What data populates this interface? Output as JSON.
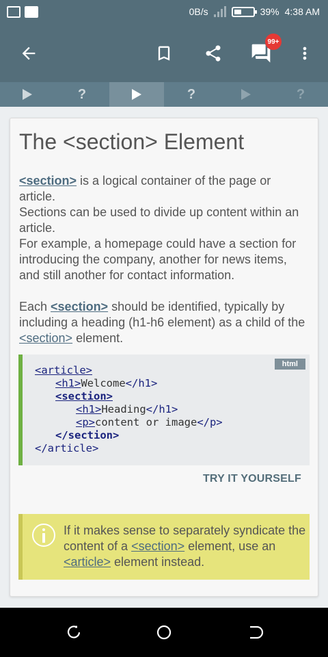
{
  "status_bar": {
    "net_speed": "0B/s",
    "battery_percent": "39%",
    "battery_level": 0.39,
    "time": "4:38 AM",
    "icons": [
      "screen-cast-icon",
      "activity-icon",
      "signal-icon",
      "battery-icon"
    ]
  },
  "app_bar": {
    "badge": "99+",
    "icons": [
      "back-arrow-icon",
      "bookmark-icon",
      "share-icon",
      "comments-icon",
      "more-vert-icon"
    ]
  },
  "lesson_nav": {
    "steps": [
      {
        "type": "play",
        "label": ""
      },
      {
        "type": "quiz",
        "label": "?"
      },
      {
        "type": "play",
        "label": "",
        "active": true
      },
      {
        "type": "quiz",
        "label": "?"
      },
      {
        "type": "play",
        "label": "",
        "disabled": true
      },
      {
        "type": "quiz",
        "label": "?",
        "disabled": true
      }
    ]
  },
  "card": {
    "title": "The <section> Element",
    "p1": {
      "link": "<section>",
      "line1_rest": " is a logical container of the page or article.",
      "line2": "Sections can be used to divide up content within an article.",
      "line3": "For example, a homepage could have a section for introducing the company, another for news items, and still another for contact information."
    },
    "p2": {
      "pre": "Each ",
      "link1": "<section>",
      "mid": " should be identified, typically by including a heading (h1-h6 element) as a child of the ",
      "link2": "<section>",
      "post": " element."
    },
    "code": {
      "lang": "html",
      "lines": [
        {
          "indent": 0,
          "open": "<article>",
          "text": "",
          "close": "",
          "open_style": "u"
        },
        {
          "indent": 1,
          "open": "<h1>",
          "text": "Welcome",
          "close": "</h1>",
          "open_style": "u"
        },
        {
          "indent": 1,
          "open": "<section>",
          "text": "",
          "close": "",
          "open_style": "ub"
        },
        {
          "indent": 2,
          "open": "<h1>",
          "text": "Heading",
          "close": "</h1>",
          "open_style": "u"
        },
        {
          "indent": 2,
          "open": "<p>",
          "text": "content or image",
          "close": "</p>",
          "open_style": "u"
        },
        {
          "indent": 1,
          "open": "</section>",
          "text": "",
          "close": "",
          "open_style": "b"
        },
        {
          "indent": 0,
          "open": "</article>",
          "text": "",
          "close": "",
          "open_style": ""
        }
      ]
    },
    "try_label": "TRY IT YOURSELF",
    "note": {
      "pre": "If it makes sense to separately syndicate the content of a ",
      "link1": "<section>",
      "mid": " element, use an ",
      "link2": "<article>",
      "post": " element instead."
    }
  },
  "nav_bar": {
    "icons": [
      "recent-apps-icon",
      "home-icon",
      "back-icon"
    ]
  }
}
